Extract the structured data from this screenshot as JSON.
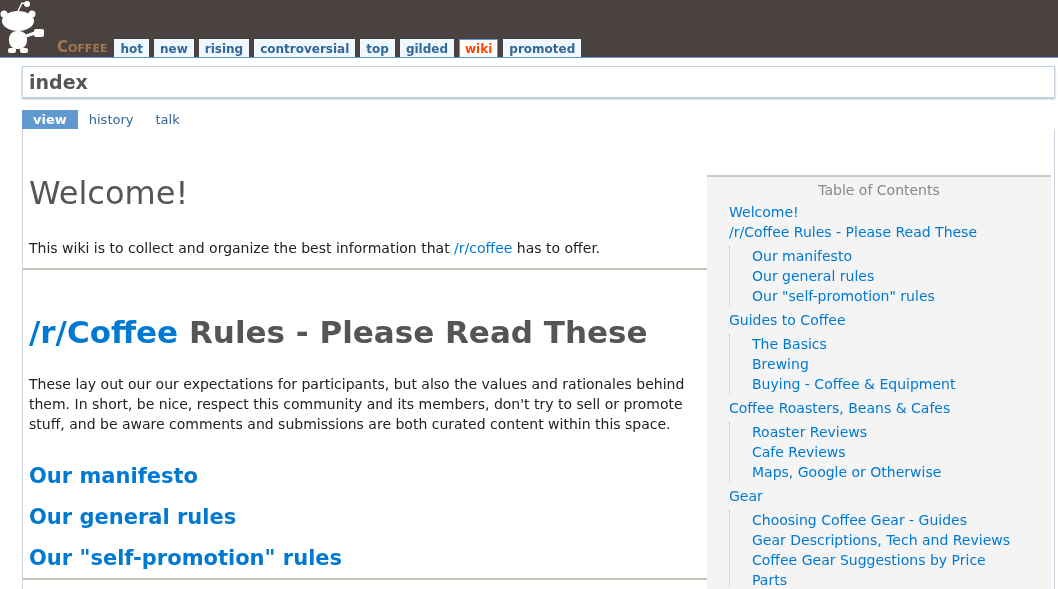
{
  "header": {
    "subreddit": "Coffee",
    "tabs": [
      {
        "label": "hot",
        "selected": false
      },
      {
        "label": "new",
        "selected": false
      },
      {
        "label": "rising",
        "selected": false
      },
      {
        "label": "controversial",
        "selected": false
      },
      {
        "label": "top",
        "selected": false
      },
      {
        "label": "gilded",
        "selected": false
      },
      {
        "label": "wiki",
        "selected": true
      },
      {
        "label": "promoted",
        "selected": false
      }
    ]
  },
  "page_title": "index",
  "page_tabs": [
    {
      "label": "view",
      "selected": true
    },
    {
      "label": "history",
      "selected": false
    },
    {
      "label": "talk",
      "selected": false
    }
  ],
  "article": {
    "welcome_heading": "Welcome!",
    "intro": {
      "before": "This wiki is to collect and organize the best information that ",
      "link": "/r/coffee",
      "after": " has to offer."
    },
    "rules_heading": {
      "link": "/r/Coffee",
      "rest": " Rules - Please Read These"
    },
    "rules_text": "These lay out our our expectations for participants, but also the values and rationales behind them. In short, be nice, respect this community and its members, don't try to sell or promote stuff, and be aware comments and submissions are both curated content within this space.",
    "subheadings": [
      "Our manifesto",
      "Our general rules",
      "Our \"self-promotion\" rules"
    ]
  },
  "toc": {
    "title": "Table of Contents",
    "items": [
      {
        "label": "Welcome!"
      },
      {
        "label": "/r/Coffee Rules - Please Read These",
        "children": [
          {
            "label": "Our manifesto"
          },
          {
            "label": "Our general rules"
          },
          {
            "label": "Our \"self-promotion\" rules"
          }
        ]
      },
      {
        "label": "Guides to Coffee",
        "children": [
          {
            "label": "The Basics"
          },
          {
            "label": "Brewing"
          },
          {
            "label": "Buying - Coffee & Equipment"
          }
        ]
      },
      {
        "label": "Coffee Roasters, Beans & Cafes",
        "children": [
          {
            "label": "Roaster Reviews"
          },
          {
            "label": "Cafe Reviews"
          },
          {
            "label": "Maps, Google or Otherwise"
          }
        ]
      },
      {
        "label": "Gear",
        "children": [
          {
            "label": "Choosing Coffee Gear - Guides"
          },
          {
            "label": "Gear Descriptions, Tech and Reviews"
          },
          {
            "label": "Coffee Gear Suggestions by Price"
          },
          {
            "label": "Parts"
          }
        ]
      }
    ]
  }
}
